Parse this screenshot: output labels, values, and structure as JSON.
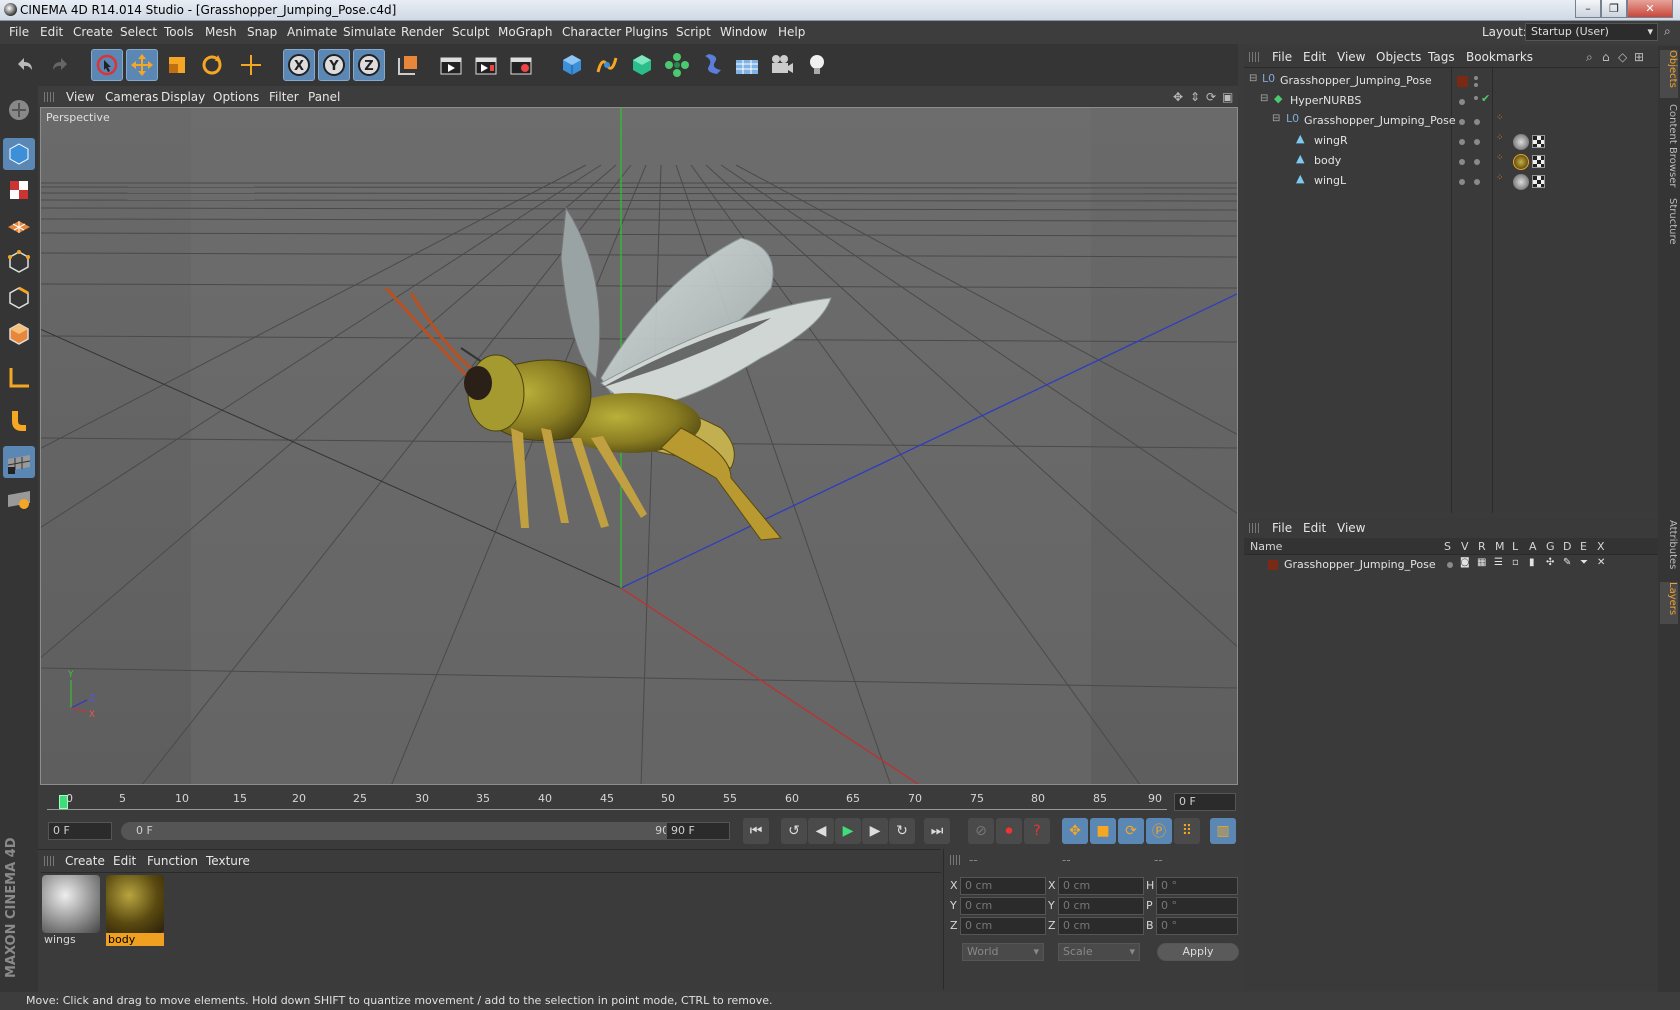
{
  "window": {
    "title": "CINEMA 4D R14.014 Studio - [Grasshopper_Jumping_Pose.c4d]"
  },
  "menu": [
    "File",
    "Edit",
    "Create",
    "Select",
    "Tools",
    "Mesh",
    "Snap",
    "Animate",
    "Simulate",
    "Render",
    "Sculpt",
    "MoGraph",
    "Character",
    "Plugins",
    "Script",
    "Window",
    "Help"
  ],
  "layout": {
    "label": "Layout:",
    "value": "Startup (User)"
  },
  "toolbar_icons": [
    "undo-icon",
    "redo-icon",
    "live-selection-icon",
    "move-icon",
    "scale-icon",
    "rotate-icon",
    "recent-tool-icon",
    "x-axis-icon",
    "y-axis-icon",
    "z-axis-icon",
    "coordinate-system-icon",
    "render-view-icon",
    "render-picture-viewer-icon",
    "render-settings-icon",
    "cube-icon",
    "spline-icon",
    "nurbs-icon",
    "array-icon",
    "deformer-icon",
    "floor-icon",
    "camera-icon",
    "light-icon"
  ],
  "viewport": {
    "menu": [
      "View",
      "Cameras",
      "Display",
      "Options",
      "Filter",
      "Panel"
    ],
    "label": "Perspective",
    "axis": {
      "y": "Y",
      "z": "Z",
      "x": "X"
    }
  },
  "timeline": {
    "ticks": [
      "0",
      "5",
      "10",
      "15",
      "20",
      "25",
      "30",
      "35",
      "40",
      "45",
      "50",
      "55",
      "60",
      "65",
      "70",
      "75",
      "80",
      "85",
      "90"
    ],
    "current_frame": "0 F",
    "start": "0 F",
    "range_start": "0 F",
    "range_end": "90 F",
    "end": "90 F"
  },
  "materials": {
    "menu": [
      "Create",
      "Edit",
      "Function",
      "Texture"
    ],
    "items": [
      {
        "name": "wings",
        "selected": false
      },
      {
        "name": "body",
        "selected": true
      }
    ]
  },
  "coords": {
    "headers": [
      "--",
      "--",
      "--"
    ],
    "rows": [
      {
        "a": "X",
        "av": "0 cm",
        "b": "X",
        "bv": "0 cm",
        "c": "H",
        "cv": "0 °"
      },
      {
        "a": "Y",
        "av": "0 cm",
        "b": "Y",
        "bv": "0 cm",
        "c": "P",
        "cv": "0 °"
      },
      {
        "a": "Z",
        "av": "0 cm",
        "b": "Z",
        "bv": "0 cm",
        "c": "B",
        "cv": "0 °"
      }
    ],
    "world": "World",
    "scale": "Scale",
    "apply": "Apply"
  },
  "objects": {
    "menu": [
      "File",
      "Edit",
      "View",
      "Objects",
      "Tags",
      "Bookmarks"
    ],
    "tree": [
      "Grasshopper_Jumping_Pose",
      "HyperNURBS",
      "Grasshopper_Jumping_Pose",
      "wingR",
      "body",
      "wingL"
    ]
  },
  "layers": {
    "menu": [
      "File",
      "Edit",
      "View"
    ],
    "columns": [
      "Name",
      "S",
      "V",
      "R",
      "M",
      "L",
      "A",
      "G",
      "D",
      "E",
      "X"
    ],
    "rows": [
      "Grasshopper_Jumping_Pose"
    ]
  },
  "right_tabs": [
    "Objects",
    "Content Browser",
    "Structure",
    "Attributes",
    "Layers"
  ],
  "branding": "MAXON CINEMA 4D",
  "status": "Move: Click and drag to move elements. Hold down SHIFT to quantize movement / add to the selection in point mode, CTRL to remove.",
  "colors": {
    "accent": "#5b87b5",
    "material_selected": "#f0a020",
    "x_axis": "#c03030",
    "y_axis": "#30c030",
    "z_axis": "#3040c0"
  }
}
